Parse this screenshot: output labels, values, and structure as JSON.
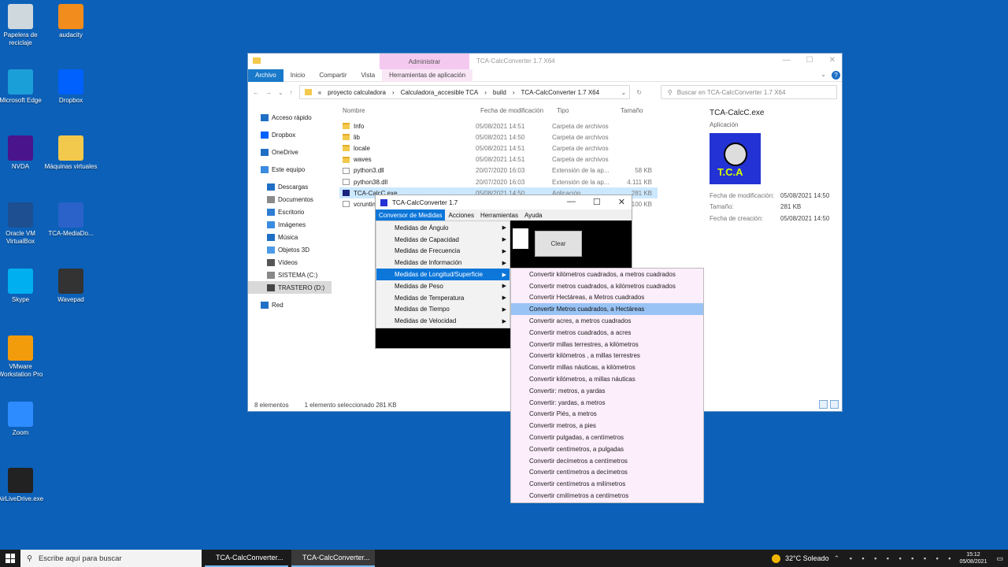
{
  "desktop": {
    "icons_left": [
      {
        "label": "Papelera de reciclaje",
        "icon": "recycle-bin-icon",
        "color": "#cfd8dc"
      },
      {
        "label": "Microsoft Edge",
        "icon": "edge-icon",
        "color": "#1b9fd8"
      },
      {
        "label": "NVDA",
        "icon": "nvda-icon",
        "color": "#4a148c"
      },
      {
        "label": "Oracle VM VirtualBox",
        "icon": "virtualbox-icon",
        "color": "#1e4f91"
      },
      {
        "label": "Skype",
        "icon": "skype-icon",
        "color": "#00aff0"
      },
      {
        "label": "VMware Workstation Pro",
        "icon": "vmware-icon",
        "color": "#f29b0b"
      },
      {
        "label": "Zoom",
        "icon": "zoom-icon",
        "color": "#2d8cff"
      },
      {
        "label": "AirLiveDrive.exe",
        "icon": "airlivedrive-icon",
        "color": "#222222"
      }
    ],
    "icons_right": [
      {
        "label": "audacity",
        "icon": "audacity-icon",
        "color": "#f28c1d"
      },
      {
        "label": "Dropbox",
        "icon": "dropbox-icon",
        "color": "#0061fe"
      },
      {
        "label": "Máquinas virtuales",
        "icon": "folder-icon",
        "color": "#f2c94c"
      },
      {
        "label": "TCA-MediaDo...",
        "icon": "tca-media-icon",
        "color": "#2a62c9"
      },
      {
        "label": "Wavepad",
        "icon": "wavepad-icon",
        "color": "#333333"
      }
    ]
  },
  "explorer": {
    "ctx_tab": "Administrar",
    "title": "TCA-CalcConverter 1.7 X64",
    "ribbon_tabs": [
      "Archivo",
      "Inicio",
      "Compartir",
      "Vista",
      "Herramientas de aplicación"
    ],
    "breadcrumb": [
      "«",
      "proyecto calculadora",
      "›",
      "Calculadora_accesible TCA",
      "›",
      "build",
      "›",
      "TCA-CalcConverter 1.7 X64"
    ],
    "search_placeholder": "Buscar en TCA-CalcConverter 1.7 X64",
    "nav": [
      {
        "label": "Acceso rápido",
        "indent": 16,
        "color": "#1f6fc5"
      },
      {
        "label": "Dropbox",
        "indent": 16,
        "color": "#0061fe"
      },
      {
        "label": "OneDrive",
        "indent": 16,
        "color": "#1f6fc5"
      },
      {
        "label": "Este equipo",
        "indent": 16,
        "color": "#3b8be0"
      },
      {
        "label": "Descargas",
        "indent": 24,
        "color": "#1f6fc5"
      },
      {
        "label": "Documentos",
        "indent": 24,
        "color": "#8a8a8a"
      },
      {
        "label": "Escritorio",
        "indent": 24,
        "color": "#2d7dd2"
      },
      {
        "label": "Imágenes",
        "indent": 24,
        "color": "#3b8be0"
      },
      {
        "label": "Música",
        "indent": 24,
        "color": "#1f6fc5"
      },
      {
        "label": "Objetos 3D",
        "indent": 24,
        "color": "#4c9be8"
      },
      {
        "label": "Vídeos",
        "indent": 24,
        "color": "#555555"
      },
      {
        "label": "SISTEMA (C:)",
        "indent": 24,
        "color": "#888888"
      },
      {
        "label": "TRASTERO (D:)",
        "indent": 24,
        "color": "#444444"
      },
      {
        "label": "Red",
        "indent": 16,
        "color": "#1f6fc5"
      }
    ],
    "columns": [
      "Nombre",
      "Fecha de modificación",
      "Tipo",
      "Tamaño"
    ],
    "files": [
      {
        "name": "Info",
        "date": "05/08/2021 14:51",
        "type": "Carpeta de archivos",
        "size": "",
        "kind": "folder"
      },
      {
        "name": "lib",
        "date": "05/08/2021 14:50",
        "type": "Carpeta de archivos",
        "size": "",
        "kind": "folder"
      },
      {
        "name": "locale",
        "date": "05/08/2021 14:51",
        "type": "Carpeta de archivos",
        "size": "",
        "kind": "folder"
      },
      {
        "name": "waves",
        "date": "05/08/2021 14:51",
        "type": "Carpeta de archivos",
        "size": "",
        "kind": "folder"
      },
      {
        "name": "python3.dll",
        "date": "20/07/2020 16:03",
        "type": "Extensión de la ap...",
        "size": "58 KB",
        "kind": "file"
      },
      {
        "name": "python38.dll",
        "date": "20/07/2020 16:03",
        "type": "Extensión de la ap...",
        "size": "4.111 KB",
        "kind": "file"
      },
      {
        "name": "TCA-CalcC.exe",
        "date": "05/08/2021 14:50",
        "type": "Aplicación",
        "size": "281 KB",
        "kind": "exe"
      },
      {
        "name": "vcruntime140.dll",
        "date": "",
        "type": "",
        "size": "100 KB",
        "kind": "file"
      }
    ],
    "preview": {
      "title": "TCA-CalcC.exe",
      "subtitle": "Aplicación",
      "image_text": "T.C.A",
      "meta": [
        {
          "k": "Fecha de modificación:",
          "v": "05/08/2021 14:50"
        },
        {
          "k": "Tamaño:",
          "v": "281 KB"
        },
        {
          "k": "Fecha de creación:",
          "v": "05/08/2021 14:50"
        }
      ]
    },
    "status_count": "8 elementos",
    "status_sel": "1 elemento seleccionado  281 KB"
  },
  "tca": {
    "title": "TCA-CalcConverter 1.7",
    "menu": [
      "Conversor de Medidas",
      "Acciones",
      "Herramientas",
      "Ayuda"
    ],
    "clear": "Clear"
  },
  "menu1": [
    "Medidas de Ángulo",
    "Medidas de Capacidad",
    "Medidas de Frecuencia",
    "Medidas de Información",
    "Medidas de Longitud/Superficie",
    "Medidas de Peso",
    "Medidas de Temperatura",
    "Medidas de Tiempo",
    "Medidas de Velocidad"
  ],
  "menu1_highlight": 4,
  "menu2": [
    "Convertir kilómetros cuadrados, a metros cuadrados",
    "Convertir metros cuadrados, a kilómetros cuadrados",
    "Convertir Hectáreas, a Metros cuadrados",
    "Convertir Metros cuadrados, a Hectáreas",
    "Convertir acres, a metros cuadrados",
    "Convertir metros cuadrados, a acres",
    "Convertir millas terrestres, a kilómetros",
    "Convertir kilómetros , a millas terrestres",
    "Convertir millas náuticas, a kilómetros",
    "Convertir kilómetros, a millas náuticas",
    "Convertir: metros, a yardas",
    "Convertir: yardas, a metros",
    "Convertir Piés, a metros",
    "Convertir metros, a pies",
    "Convertir pulgadas, a centímetros",
    "Convertir centímetros, a pulgadas",
    "Convertir decímetros a centímetros",
    "Convertir centímetros a decímetros",
    "Convertir centímetros a milímetros",
    "Convertir cmilímetros a centímetros"
  ],
  "menu2_highlight": 3,
  "taskbar": {
    "search": "Escribe aquí para buscar",
    "apps": [
      "TCA-CalcConverter...",
      "TCA-CalcConverter..."
    ],
    "weather": "32°C  Soleado",
    "time": "15:12",
    "date": "05/08/2021"
  },
  "colors": {
    "desktop": "#0c60b8",
    "accent": "#0c76d9",
    "menu_hover": "#99c3f4",
    "menu2_bg": "#fdeefb"
  }
}
